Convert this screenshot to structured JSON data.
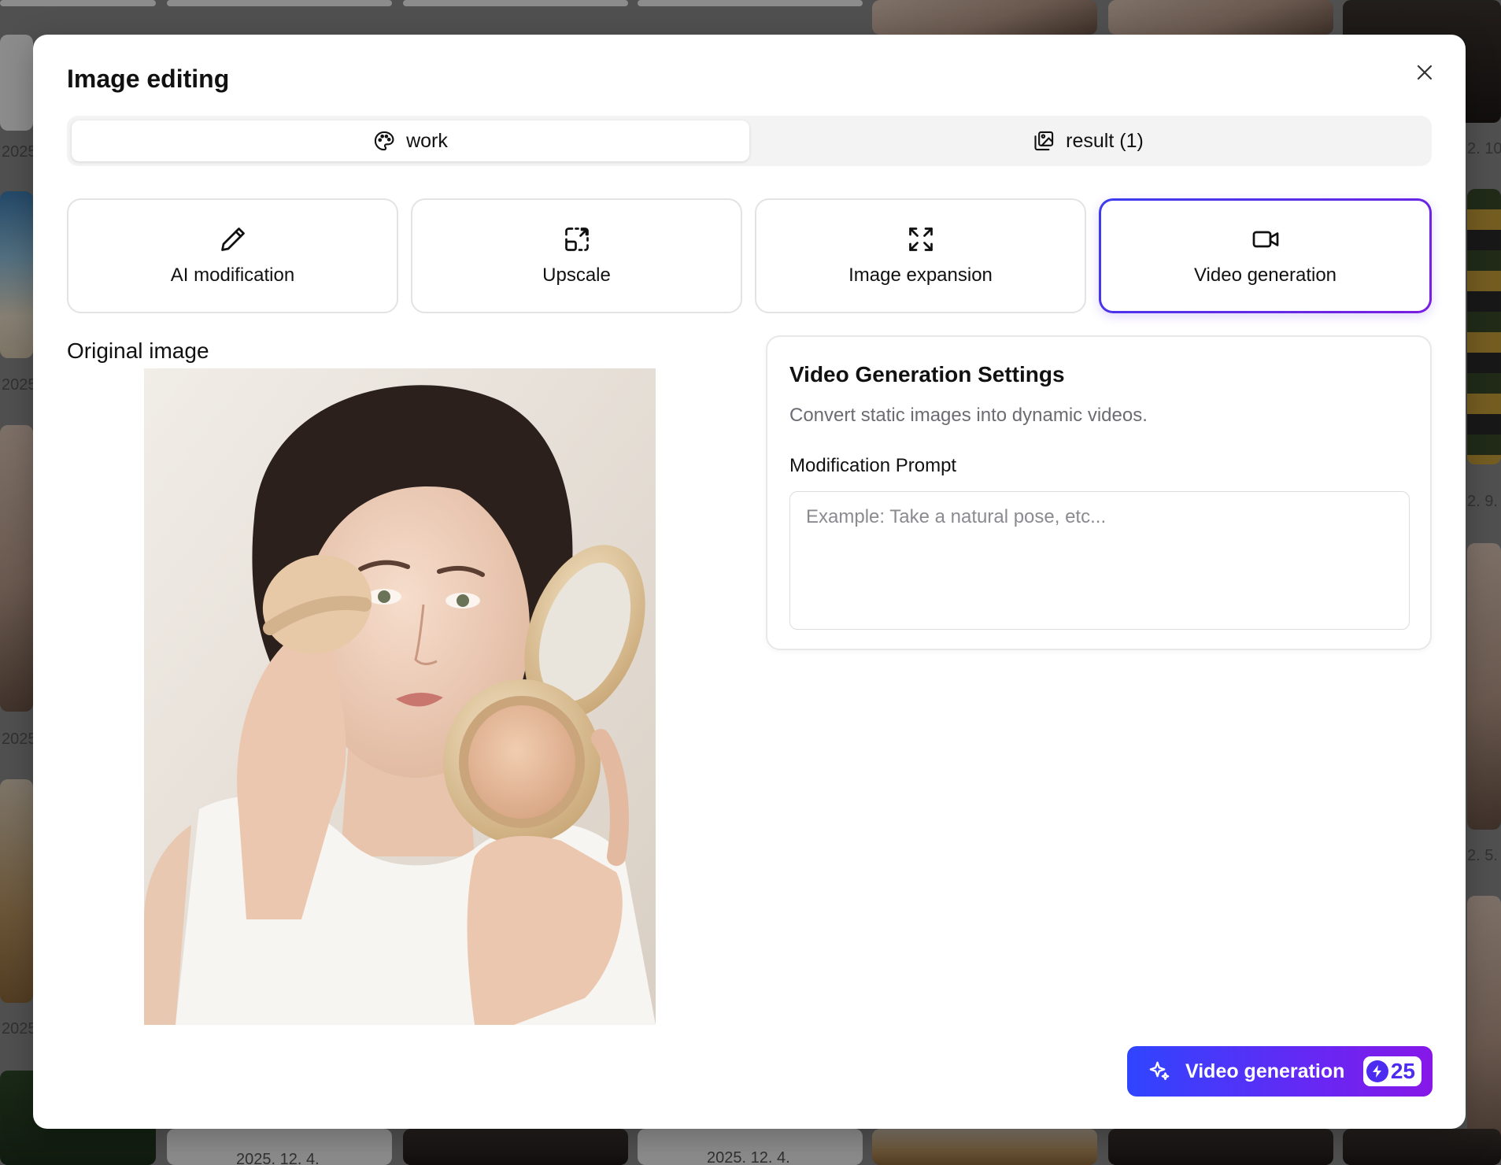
{
  "background": {
    "dates": [
      "2025",
      "2025",
      "2025",
      "2025",
      "2025",
      "2. 10.",
      "2. 9.",
      "2. 5.",
      "2025. 12. 4.",
      "2025. 12. 4."
    ]
  },
  "modal": {
    "title": "Image editing",
    "tabs": [
      {
        "label": "work",
        "icon": "palette-icon",
        "active": true
      },
      {
        "label": "result (1)",
        "icon": "gallery-icon",
        "active": false
      }
    ],
    "tools": [
      {
        "label": "AI modification",
        "icon": "pencil-icon",
        "selected": false
      },
      {
        "label": "Upscale",
        "icon": "upscale-icon",
        "selected": false
      },
      {
        "label": "Image expansion",
        "icon": "expand-icon",
        "selected": false
      },
      {
        "label": "Video generation",
        "icon": "video-camera-icon",
        "selected": true
      }
    ],
    "original_label": "Original image",
    "settings": {
      "title": "Video Generation Settings",
      "description": "Convert static images into dynamic videos.",
      "prompt_label": "Modification Prompt",
      "prompt_value": "",
      "prompt_placeholder": "Example: Take a natural pose, etc..."
    },
    "generate_button": {
      "label": "Video generation",
      "credits": "25"
    }
  },
  "colors": {
    "accent_start": "#2f45ff",
    "accent_end": "#8618e8"
  }
}
